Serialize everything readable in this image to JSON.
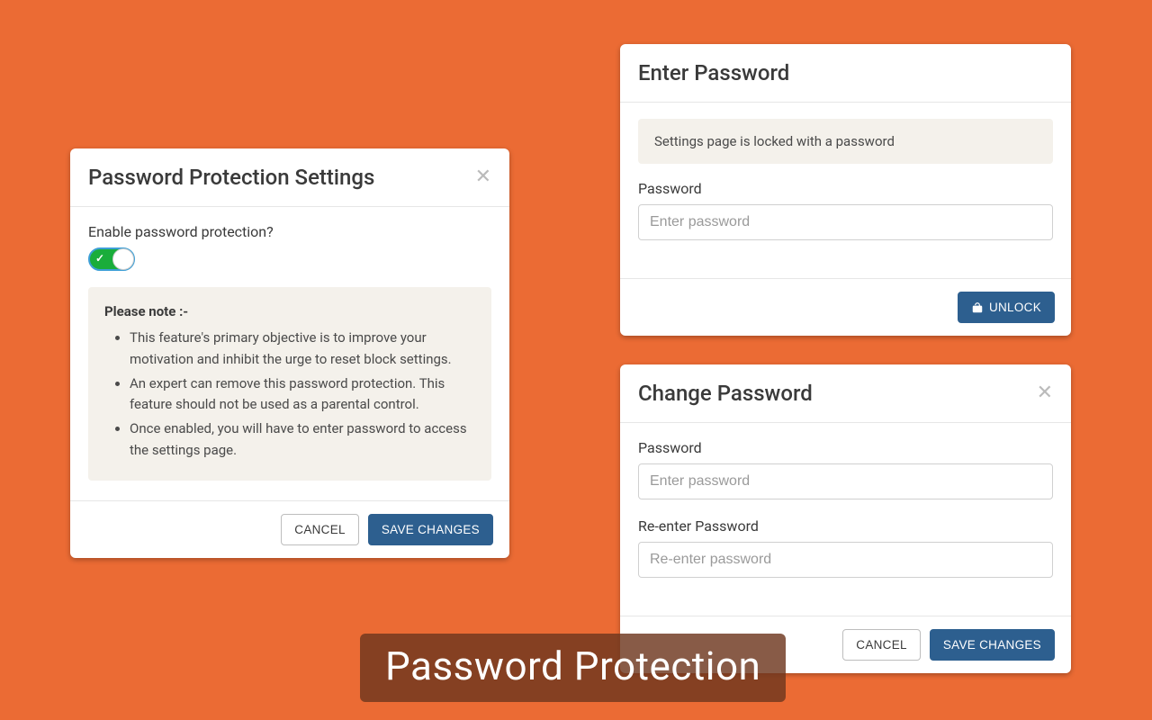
{
  "settings_card": {
    "title": "Password Protection Settings",
    "enable_label": "Enable password protection?",
    "note_heading": "Please note :-",
    "notes": [
      "This feature's primary objective is to improve your motivation and inhibit the urge to reset block settings.",
      "An expert can remove this password protection. This feature should not be used as a parental control.",
      "Once enabled, you will have to enter password to access the settings page."
    ],
    "cancel_label": "CANCEL",
    "save_label": "SAVE CHANGES",
    "toggle_on": true
  },
  "enter_card": {
    "title": "Enter Password",
    "info_text": "Settings page is locked with a password",
    "password_label": "Password",
    "password_placeholder": "Enter password",
    "unlock_label": "UNLOCK"
  },
  "change_card": {
    "title": "Change Password",
    "password_label": "Password",
    "password_placeholder": "Enter password",
    "reenter_label": "Re-enter Password",
    "reenter_placeholder": "Re-enter password",
    "cancel_label": "CANCEL",
    "save_label": "SAVE CHANGES"
  },
  "banner_text": "Password Protection"
}
